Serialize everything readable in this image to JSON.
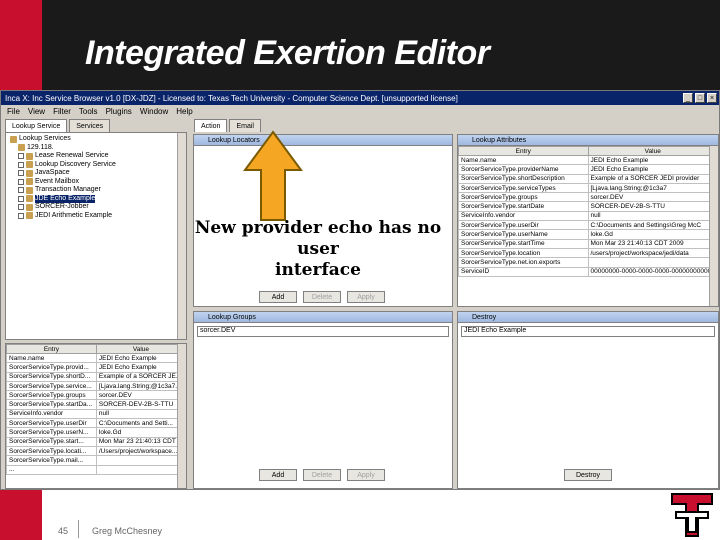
{
  "slide": {
    "title": "Integrated Exertion Editor",
    "page_number": "45",
    "author": "Greg McChesney",
    "callout": [
      "New provider echo has no user",
      "interface"
    ]
  },
  "window": {
    "title": "Inca X: Inc Service Browser v1.0 [DX-JDZ] - Licensed to: Texas Tech University - Computer Science Dept. [unsupported license]",
    "menu": [
      "File",
      "View",
      "Filter",
      "Tools",
      "Plugins",
      "Window",
      "Help"
    ]
  },
  "left_tabs": [
    "Lookup Service",
    "Services"
  ],
  "tree": {
    "root": "Lookup Services",
    "host": "129.118.",
    "items": [
      "Lease Renewal Service",
      "Lookup Discovery Service",
      "JavaSpace",
      "Event Mailbox",
      "Transaction Manager",
      "JDE Echo Example",
      "SORCER-Jobber",
      "JEDI Arithmetic Example"
    ],
    "selected_index": 5
  },
  "left_table": {
    "headers": [
      "Entry",
      "Value"
    ],
    "rows": [
      [
        "Name.name",
        "JEDI Echo Example"
      ],
      [
        "SorcerServiceType.provid...",
        "JEDI Echo Example"
      ],
      [
        "SorcerServiceType.shortD...",
        "Example of a SORCER JE..."
      ],
      [
        "SorcerServiceType.service...",
        "[Ljava.lang.String;@1c3a7..."
      ],
      [
        "SorcerServiceType.groups",
        "sorcer.DEV"
      ],
      [
        "SorcerServiceType.startDa...",
        "SORCER-DEV-2B-S-TTU"
      ],
      [
        "ServiceInfo.vendor",
        "null"
      ],
      [
        "SorcerServiceType.userDir",
        "C:\\Documents and Setti..."
      ],
      [
        "SorcerServiceType.userN...",
        "loke.Gd"
      ],
      [
        "SorcerServiceType.start...",
        "Mon Mar 23 21:40:13 CDT"
      ],
      [
        "SorcerServiceType.locati...",
        "/Users/project/workspace..."
      ],
      [
        "SorcerServiceType.mail...",
        ""
      ],
      [
        "...",
        ""
      ]
    ]
  },
  "center_tabs": [
    "Action",
    "Email"
  ],
  "lookup_locator": {
    "label": "Lookup Locators"
  },
  "lookup_attributes": {
    "label": "Lookup Attributes",
    "headers": [
      "Entry",
      "Value"
    ],
    "rows": [
      [
        "Name.name",
        "JEDI Echo Example"
      ],
      [
        "SorcerServiceType.providerName",
        "JEDI Echo Example"
      ],
      [
        "SorcerServiceType.shortDescription",
        "Example of a SORCER JEDI provider"
      ],
      [
        "SorcerServiceType.serviceTypes",
        "[Ljava.lang.String;@1c3a7"
      ],
      [
        "SorcerServiceType.groups",
        "sorcer.DEV"
      ],
      [
        "SorcerServiceType.startDate",
        "SORCER-DEV-2B-S-TTU"
      ],
      [
        "ServiceInfo.vendor",
        "null"
      ],
      [
        "SorcerServiceType.userDir",
        "C:\\Documents and Settings\\Greg McC"
      ],
      [
        "SorcerServiceType.userName",
        "loke.Gd"
      ],
      [
        "SorcerServiceType.startTime",
        "Mon Mar 23 21:40:13 CDT 2009"
      ],
      [
        "SorcerServiceType.location",
        "/users/project/workspace/jedi/data"
      ],
      [
        "SorcerServiceType.net.ion.exports",
        ""
      ],
      [
        "ServiceID",
        "00000000-0000-0000-0000-000000000000"
      ]
    ]
  },
  "buttons": {
    "add": "Add",
    "delete": "Delete",
    "apply": "Apply",
    "add2": "Add",
    "delete2": "Delete",
    "apply2": "Apply",
    "destroy": "Destroy"
  },
  "lookup_groups": {
    "label": "Lookup Groups",
    "value": "sorcer.DEV"
  },
  "destroy_panel": {
    "label": "Destroy",
    "value": "JEDI Echo Example"
  },
  "colors": {
    "accent_red": "#c8102e",
    "header_dark": "#1a1a1a",
    "arrow_orange": "#f5a623"
  }
}
